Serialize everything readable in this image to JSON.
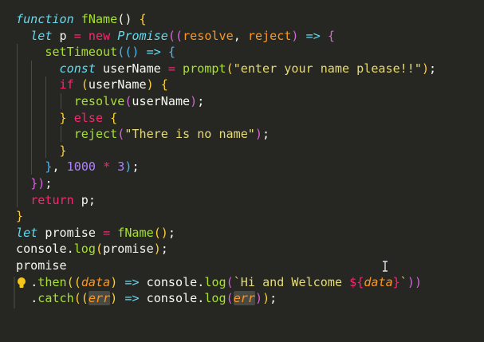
{
  "editor": {
    "theme_colors": {
      "background": "#262722",
      "keyword": "#66d9ef",
      "storage": "#f92672",
      "function": "#a6e22e",
      "string": "#e6db74",
      "number": "#ae81ff",
      "param": "#fd971f",
      "text": "#f8f8f2",
      "paren": "#f92672"
    },
    "lines": [
      [
        [
          "function",
          "#66d9ef",
          "italic"
        ],
        [
          " ",
          "#f8f8f2"
        ],
        [
          "fName",
          "#a6e22e"
        ],
        [
          "()",
          "#f8f8f2"
        ],
        [
          " {",
          "#fcd036"
        ]
      ],
      [
        [
          "  "
        ],
        [
          "let",
          "#66d9ef",
          "italic"
        ],
        [
          " p ",
          "#f8f8f2"
        ],
        [
          "=",
          "#f92672"
        ],
        [
          " ",
          "#f8f8f2"
        ],
        [
          "new",
          "#f92672"
        ],
        [
          " ",
          "#f8f8f2"
        ],
        [
          "Promise",
          "#66d9ef",
          "italic"
        ],
        [
          "((",
          "#d565d8"
        ],
        [
          "resolve",
          "#fd971f"
        ],
        [
          ", ",
          "#f8f8f2"
        ],
        [
          "reject",
          "#fd971f"
        ],
        [
          ")",
          "#d565d8"
        ],
        [
          " ",
          "#f8f8f2"
        ],
        [
          "=>",
          "#66d9ef"
        ],
        [
          " {",
          "#d565d8"
        ]
      ],
      [
        [
          "    "
        ],
        [
          "setTimeout",
          "#a6e22e"
        ],
        [
          "((",
          "#4fb6f5"
        ],
        [
          ")",
          "#4fb6f5"
        ],
        [
          " ",
          "#f8f8f2"
        ],
        [
          "=>",
          "#66d9ef"
        ],
        [
          " {",
          "#4fb6f5"
        ]
      ],
      [
        [
          "      "
        ],
        [
          "const",
          "#66d9ef",
          "italic"
        ],
        [
          " userName ",
          "#f8f8f2"
        ],
        [
          "=",
          "#f92672"
        ],
        [
          " ",
          "#f8f8f2"
        ],
        [
          "prompt",
          "#a6e22e"
        ],
        [
          "(",
          "#fcd036"
        ],
        [
          "\"enter your name please!!\"",
          "#e6db74"
        ],
        [
          ")",
          "#fcd036"
        ],
        [
          ";",
          "#f8f8f2"
        ]
      ],
      [
        [
          "      "
        ],
        [
          "if",
          "#f92672"
        ],
        [
          " (",
          "#fcd036"
        ],
        [
          "userName",
          "#f8f8f2"
        ],
        [
          ")",
          "#fcd036"
        ],
        [
          " {",
          "#fcd036"
        ]
      ],
      [
        [
          "        "
        ],
        [
          "resolve",
          "#a6e22e"
        ],
        [
          "(",
          "#d565d8"
        ],
        [
          "userName",
          "#f8f8f2"
        ],
        [
          ")",
          "#d565d8"
        ],
        [
          ";",
          "#f8f8f2"
        ]
      ],
      [
        [
          "      "
        ],
        [
          "}",
          "#fcd036"
        ],
        [
          " ",
          "#f8f8f2"
        ],
        [
          "else",
          "#f92672"
        ],
        [
          " {",
          "#fcd036"
        ]
      ],
      [
        [
          "        "
        ],
        [
          "reject",
          "#a6e22e"
        ],
        [
          "(",
          "#d565d8"
        ],
        [
          "\"There is no name\"",
          "#e6db74"
        ],
        [
          ")",
          "#d565d8"
        ],
        [
          ";",
          "#f8f8f2"
        ]
      ],
      [
        [
          "      "
        ],
        [
          "}",
          "#fcd036"
        ]
      ],
      [
        [
          "    "
        ],
        [
          "}",
          "#4fb6f5"
        ],
        [
          ", ",
          "#f8f8f2"
        ],
        [
          "1000",
          "#ae81ff"
        ],
        [
          " ",
          "#f8f8f2"
        ],
        [
          "*",
          "#f92672"
        ],
        [
          " ",
          "#f8f8f2"
        ],
        [
          "3",
          "#ae81ff"
        ],
        [
          ")",
          "#4fb6f5"
        ],
        [
          ";",
          "#f8f8f2"
        ]
      ],
      [
        [
          "  "
        ],
        [
          "})",
          "#d565d8"
        ],
        [
          ";",
          "#f8f8f2"
        ]
      ],
      [
        [
          "  "
        ],
        [
          "return",
          "#f92672"
        ],
        [
          " p;",
          "#f8f8f2"
        ]
      ],
      [
        [
          "}",
          "#fcd036"
        ]
      ],
      [
        [
          "let",
          "#66d9ef",
          "italic"
        ],
        [
          " promise ",
          "#f8f8f2"
        ],
        [
          "=",
          "#f92672"
        ],
        [
          " ",
          "#f8f8f2"
        ],
        [
          "fName",
          "#a6e22e"
        ],
        [
          "()",
          "#fcd036"
        ],
        [
          ";",
          "#f8f8f2"
        ]
      ],
      [
        [
          "console",
          "#f8f8f2"
        ],
        [
          ".",
          "#f8f8f2"
        ],
        [
          "log",
          "#a6e22e"
        ],
        [
          "(",
          "#fcd036"
        ],
        [
          "promise",
          "#f8f8f2"
        ],
        [
          ")",
          "#fcd036"
        ],
        [
          ";",
          "#f8f8f2"
        ]
      ],
      [
        [
          "promise",
          "#f8f8f2"
        ]
      ],
      [
        [
          "  "
        ],
        [
          ".",
          "#f8f8f2"
        ],
        [
          "then",
          "#a6e22e"
        ],
        [
          "((",
          "#fcd036"
        ],
        [
          "data",
          "#fd971f",
          "italic"
        ],
        [
          ")",
          "#fcd036"
        ],
        [
          " ",
          "#f8f8f2"
        ],
        [
          "=>",
          "#66d9ef"
        ],
        [
          " console",
          "#f8f8f2"
        ],
        [
          ".",
          "#f8f8f2"
        ],
        [
          "log",
          "#a6e22e"
        ],
        [
          "(",
          "#d565d8"
        ],
        [
          "`Hi and Welcome ",
          "#e6db74"
        ],
        [
          "${",
          "#f92672"
        ],
        [
          "data",
          "#fd971f",
          "italic"
        ],
        [
          "}",
          "#f92672"
        ],
        [
          "`",
          "#e6db74"
        ],
        [
          "))",
          "#d565d8"
        ]
      ],
      [
        [
          "  "
        ],
        [
          ".",
          "#f8f8f2"
        ],
        [
          "catch",
          "#a6e22e"
        ],
        [
          "((",
          "#fcd036"
        ],
        [
          "err",
          "#fd971f",
          "italic",
          "hl"
        ],
        [
          ")",
          "#fcd036"
        ],
        [
          " ",
          "#f8f8f2"
        ],
        [
          "=>",
          "#66d9ef"
        ],
        [
          " console",
          "#f8f8f2"
        ],
        [
          ".",
          "#f8f8f2"
        ],
        [
          "log",
          "#a6e22e"
        ],
        [
          "(",
          "#d565d8"
        ],
        [
          "err",
          "#fd971f",
          "italic",
          "hl"
        ],
        [
          ")",
          "#d565d8"
        ],
        [
          ")",
          "#fcd036"
        ],
        [
          ";",
          "#f8f8f2"
        ]
      ]
    ],
    "lightbulb_icon": "lightbulb-icon",
    "text_cursor_icon": "ibeam-cursor-icon"
  }
}
